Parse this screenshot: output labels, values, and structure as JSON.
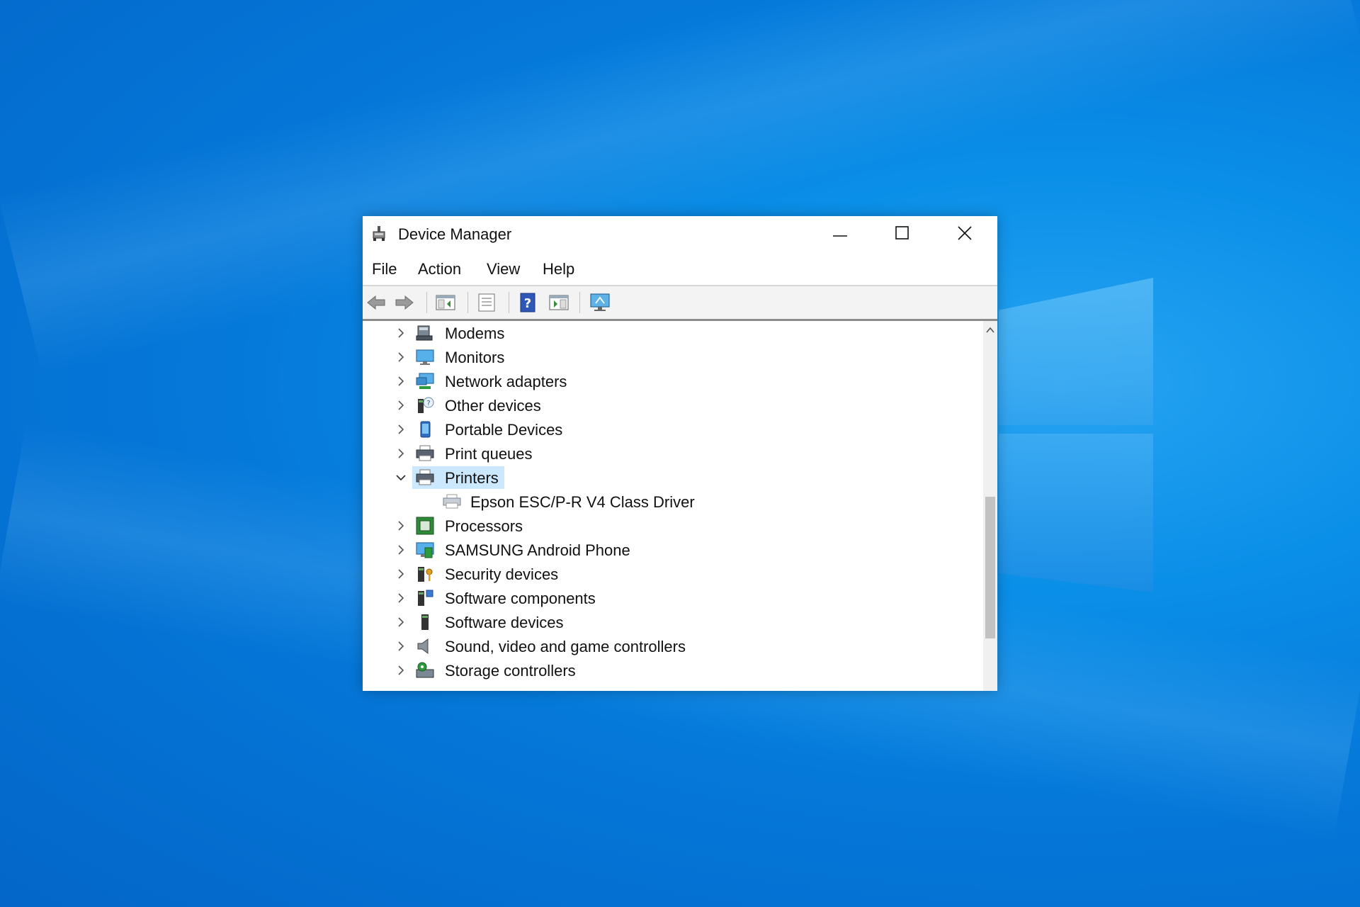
{
  "window": {
    "title": "Device Manager",
    "controls": {
      "minimize": "minimize",
      "maximize": "maximize",
      "close": "close"
    }
  },
  "menu": {
    "items": [
      {
        "label": "File"
      },
      {
        "label": "Action"
      },
      {
        "label": "View"
      },
      {
        "label": "Help"
      }
    ]
  },
  "toolbar": {
    "buttons": [
      {
        "icon": "back-arrow-icon"
      },
      {
        "icon": "forward-arrow-icon"
      },
      {
        "icon": "show-hide-console-tree-icon"
      },
      {
        "icon": "properties-icon"
      },
      {
        "icon": "help-icon"
      },
      {
        "icon": "update-driver-icon"
      },
      {
        "icon": "monitor-scan-icon"
      }
    ]
  },
  "tree": {
    "items": [
      {
        "label": "Modems",
        "icon": "modem-icon",
        "expanded": false
      },
      {
        "label": "Monitors",
        "icon": "monitor-icon",
        "expanded": false
      },
      {
        "label": "Network adapters",
        "icon": "network-adapter-icon",
        "expanded": false
      },
      {
        "label": "Other devices",
        "icon": "other-devices-icon",
        "expanded": false
      },
      {
        "label": "Portable Devices",
        "icon": "portable-device-icon",
        "expanded": false
      },
      {
        "label": "Print queues",
        "icon": "print-queue-icon",
        "expanded": false
      },
      {
        "label": "Printers",
        "icon": "printer-icon",
        "expanded": true,
        "selected": true,
        "children": [
          {
            "label": "Epson ESC/P-R V4 Class Driver",
            "icon": "printer-device-icon"
          }
        ]
      },
      {
        "label": "Processors",
        "icon": "processor-icon",
        "expanded": false
      },
      {
        "label": "SAMSUNG Android Phone",
        "icon": "phone-icon",
        "expanded": false
      },
      {
        "label": "Security devices",
        "icon": "security-device-icon",
        "expanded": false
      },
      {
        "label": "Software components",
        "icon": "software-component-icon",
        "expanded": false
      },
      {
        "label": "Software devices",
        "icon": "software-device-icon",
        "expanded": false
      },
      {
        "label": "Sound, video and game controllers",
        "icon": "speaker-icon",
        "expanded": false
      },
      {
        "label": "Storage controllers",
        "icon": "storage-controller-icon",
        "expanded": false
      }
    ]
  },
  "colors": {
    "selection": "#cce8ff",
    "desktop": "#0a8fe8"
  }
}
